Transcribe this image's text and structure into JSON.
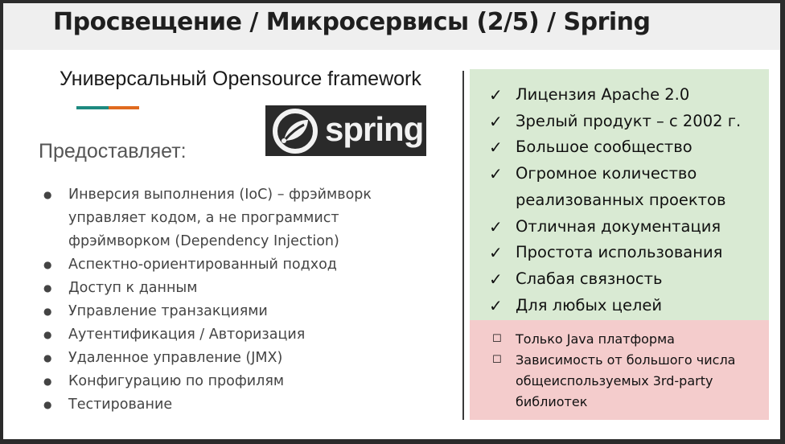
{
  "header": {
    "title": "Просвещение / Микросервисы (2/5) / Spring"
  },
  "left": {
    "subtitle": "Универсальный Opensource framework",
    "logo_text": "spring",
    "provides_label": "Предоставляет:",
    "features": [
      {
        "text": "Инверсия выполнения (IoC) – фрэймворк"
      },
      {
        "text": "управляет кодом, а не программист"
      },
      {
        "text": "фрэймворком (Dependency Injection)"
      },
      {
        "text": "Аспектно-ориентированный подход"
      },
      {
        "text": "Доступ к данным"
      },
      {
        "text": "Управление транзакциями"
      },
      {
        "text": "Аутентификация / Авторизация"
      },
      {
        "text": "Удаленное управление (JMX)"
      },
      {
        "text": "Конфигурацию по профилям"
      },
      {
        "text": "Тестирование"
      }
    ],
    "bullet_glyph": "●"
  },
  "pros": {
    "check_glyph": "✓",
    "items": [
      "Лицензия Apache 2.0",
      "Зрелый продукт – с 2002 г.",
      "Большое сообщество",
      "Огромное количество",
      "реализованных проектов",
      "Отличная документация",
      "Простота использования",
      "Слабая связность",
      "Для любых целей"
    ],
    "color": "#d9ead3"
  },
  "cons": {
    "box_glyph": "☐",
    "items": [
      "Только Java платформа",
      "Зависимость от большого числа",
      "общеиспользуемых 3rd-party",
      "библиотек"
    ],
    "color": "#f4cccc"
  },
  "accent_colors": {
    "teal": "#1e8a80",
    "orange": "#e06a1f"
  }
}
